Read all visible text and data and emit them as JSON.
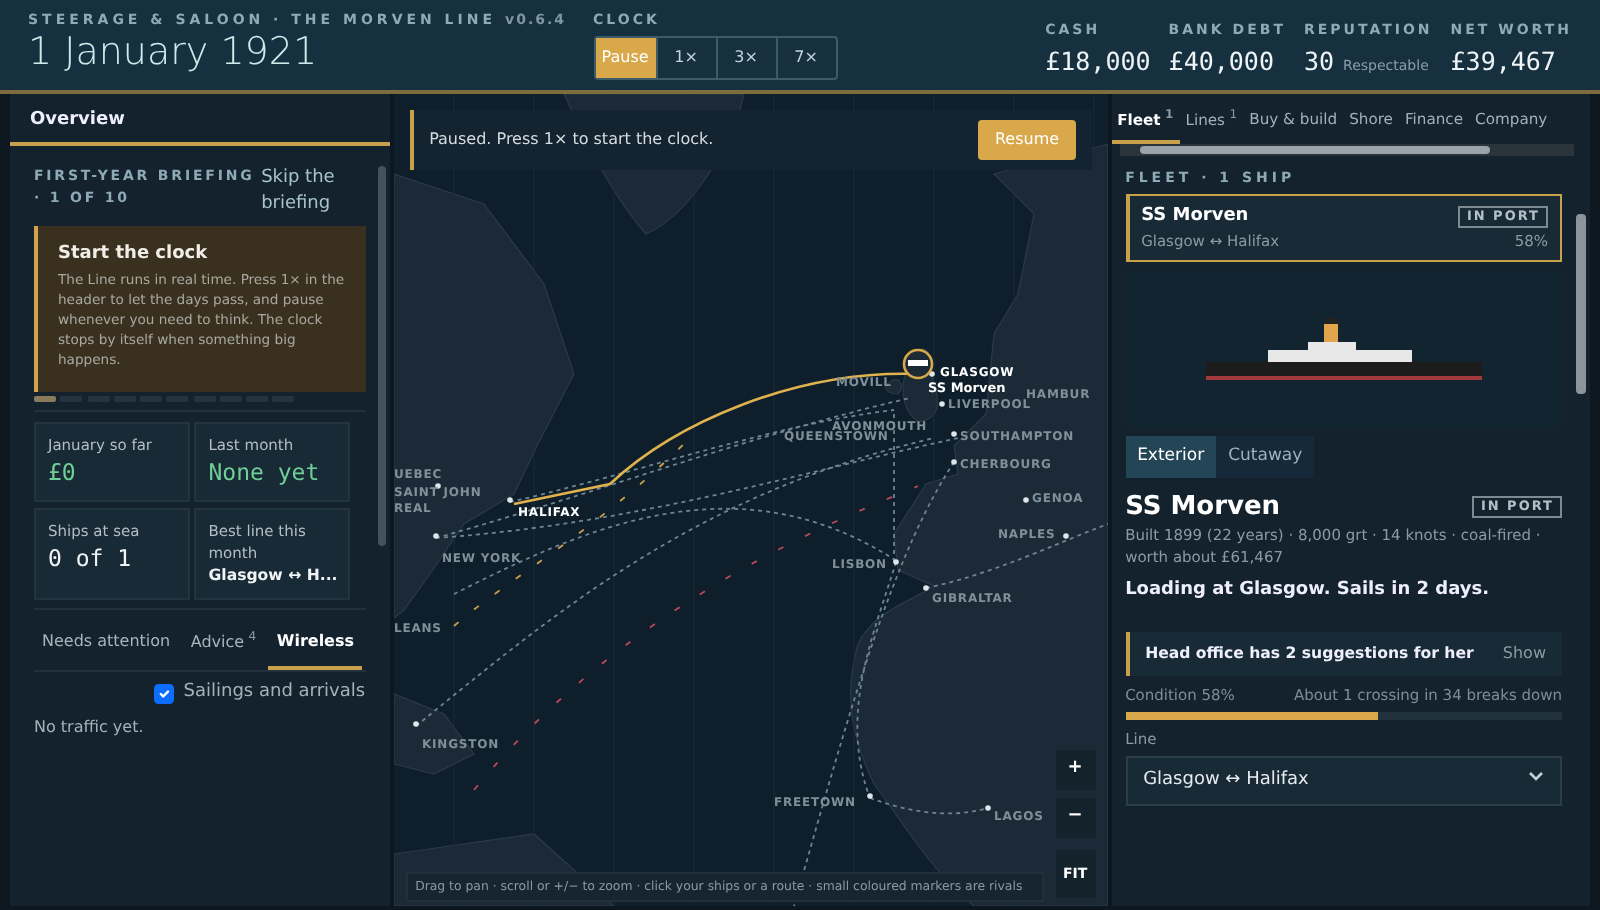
{
  "header": {
    "subtitle": "STEERAGE & SALOON · THE MORVEN LINE",
    "version": "v0.6.4",
    "date": "1 January 1921",
    "clock": {
      "label": "CLOCK",
      "speeds": [
        {
          "label": "Pause",
          "selected": true
        },
        {
          "label": "1×",
          "selected": false
        },
        {
          "label": "3×",
          "selected": false
        },
        {
          "label": "7×",
          "selected": false
        }
      ]
    },
    "stats": [
      {
        "label": "CASH",
        "value": "£18,000"
      },
      {
        "label": "BANK DEBT",
        "value": "£40,000"
      },
      {
        "label": "REPUTATION",
        "value": "30",
        "note": "Respectable"
      },
      {
        "label": "NET WORTH",
        "value": "£39,467"
      }
    ]
  },
  "left_panel": {
    "tab": "Overview",
    "briefing": {
      "heading": "FIRST-YEAR BRIEFING · 1 OF 10",
      "skip": "Skip the briefing",
      "title": "Start the clock",
      "body": "The Line runs in real time. Press 1× in the header to let the days pass, and pause whenever you need to think. The clock stops by itself when something big happens.",
      "steps": [
        {
          "selected": true
        },
        {
          "selected": false
        },
        {
          "selected": false
        },
        {
          "selected": false
        },
        {
          "selected": false
        },
        {
          "selected": false
        },
        {
          "selected": false
        },
        {
          "selected": false
        },
        {
          "selected": false
        },
        {
          "selected": false
        }
      ]
    },
    "stat_cards": [
      {
        "label": "January so far",
        "value": "£0",
        "kind": "money"
      },
      {
        "label": "Last month",
        "value": "None yet",
        "kind": "money"
      },
      {
        "label": "Ships at sea",
        "value": "0 of 1",
        "kind": "count"
      },
      {
        "label": "Best line this month",
        "value": "Glasgow ↔ H...",
        "kind": "text"
      }
    ],
    "tabs": [
      {
        "label": "Needs attention",
        "selected": false
      },
      {
        "label": "Advice",
        "badge": "4",
        "selected": false
      },
      {
        "label": "Wireless",
        "selected": true
      }
    ],
    "filter": {
      "label": "Sailings and arrivals",
      "checked": true
    },
    "empty_text": "No traffic yet."
  },
  "map": {
    "banner": "Paused. Press 1× to start the clock.",
    "resume": "Resume",
    "ports": [
      {
        "label": "GLASGOW",
        "highlighted": true
      },
      {
        "label": "MOVILL",
        "highlighted": false
      },
      {
        "label": "LIVERPOOL",
        "highlighted": false
      },
      {
        "label": "HAMBUR",
        "highlighted": false
      },
      {
        "label": "AVONMOUTH",
        "highlighted": false
      },
      {
        "label": "QUEENSTOWN",
        "highlighted": false
      },
      {
        "label": "SOUTHAMPTON",
        "highlighted": false
      },
      {
        "label": "CHERBOURG",
        "highlighted": false
      },
      {
        "label": "GENOA",
        "highlighted": false
      },
      {
        "label": "NAPLES",
        "highlighted": false
      },
      {
        "label": "LISBON",
        "highlighted": false
      },
      {
        "label": "GIBRALTAR",
        "highlighted": false
      },
      {
        "label": "UEBEC",
        "highlighted": false
      },
      {
        "label": "SAINT JOHN",
        "highlighted": false
      },
      {
        "label": "REAL",
        "highlighted": false
      },
      {
        "label": "HALIFAX",
        "highlighted": true
      },
      {
        "label": "NEW YORK",
        "highlighted": false
      },
      {
        "label": "LEANS",
        "highlighted": false
      },
      {
        "label": "KINGSTON",
        "highlighted": false
      },
      {
        "label": "FREETOWN",
        "highlighted": false
      },
      {
        "label": "LAGOS",
        "highlighted": false
      }
    ],
    "ship_label": "SS Morven",
    "zoom_in": "+",
    "zoom_out": "−",
    "fit": "FIT",
    "hint": "Drag to pan · scroll or +/− to zoom · click your ships or a route · small coloured markers are rivals"
  },
  "right_panel": {
    "tabs": [
      {
        "label": "Fleet",
        "badge": "1",
        "selected": true
      },
      {
        "label": "Lines",
        "badge": "1",
        "selected": false
      },
      {
        "label": "Buy & build",
        "selected": false
      },
      {
        "label": "Shore",
        "selected": false
      },
      {
        "label": "Finance",
        "selected": false
      },
      {
        "label": "Company",
        "selected": false
      }
    ],
    "fleet_heading": "FLEET · 1 SHIP",
    "ships": [
      {
        "name": "SS Morven",
        "status": "IN PORT",
        "route": "Glasgow ↔ Halifax",
        "condition": "58%",
        "selected": true
      }
    ],
    "views": [
      {
        "label": "Exterior",
        "selected": true
      },
      {
        "label": "Cutaway",
        "selected": false
      }
    ],
    "detail": {
      "name": "SS Morven",
      "status": "IN PORT",
      "specs": "Built 1899 (22 years) · 8,000 grt · 14 knots · coal-fired · worth about £61,467",
      "activity": "Loading at Glasgow. Sails in 2 days.",
      "suggestion": "Head office has 2 suggestions for her",
      "suggestion_action": "Show",
      "condition_label": "Condition 58%",
      "breakdown": "About 1 crossing in 34 breaks down",
      "level": 0.58,
      "line_label": "Line",
      "line_value": "Glasgow ↔ Halifax"
    }
  }
}
